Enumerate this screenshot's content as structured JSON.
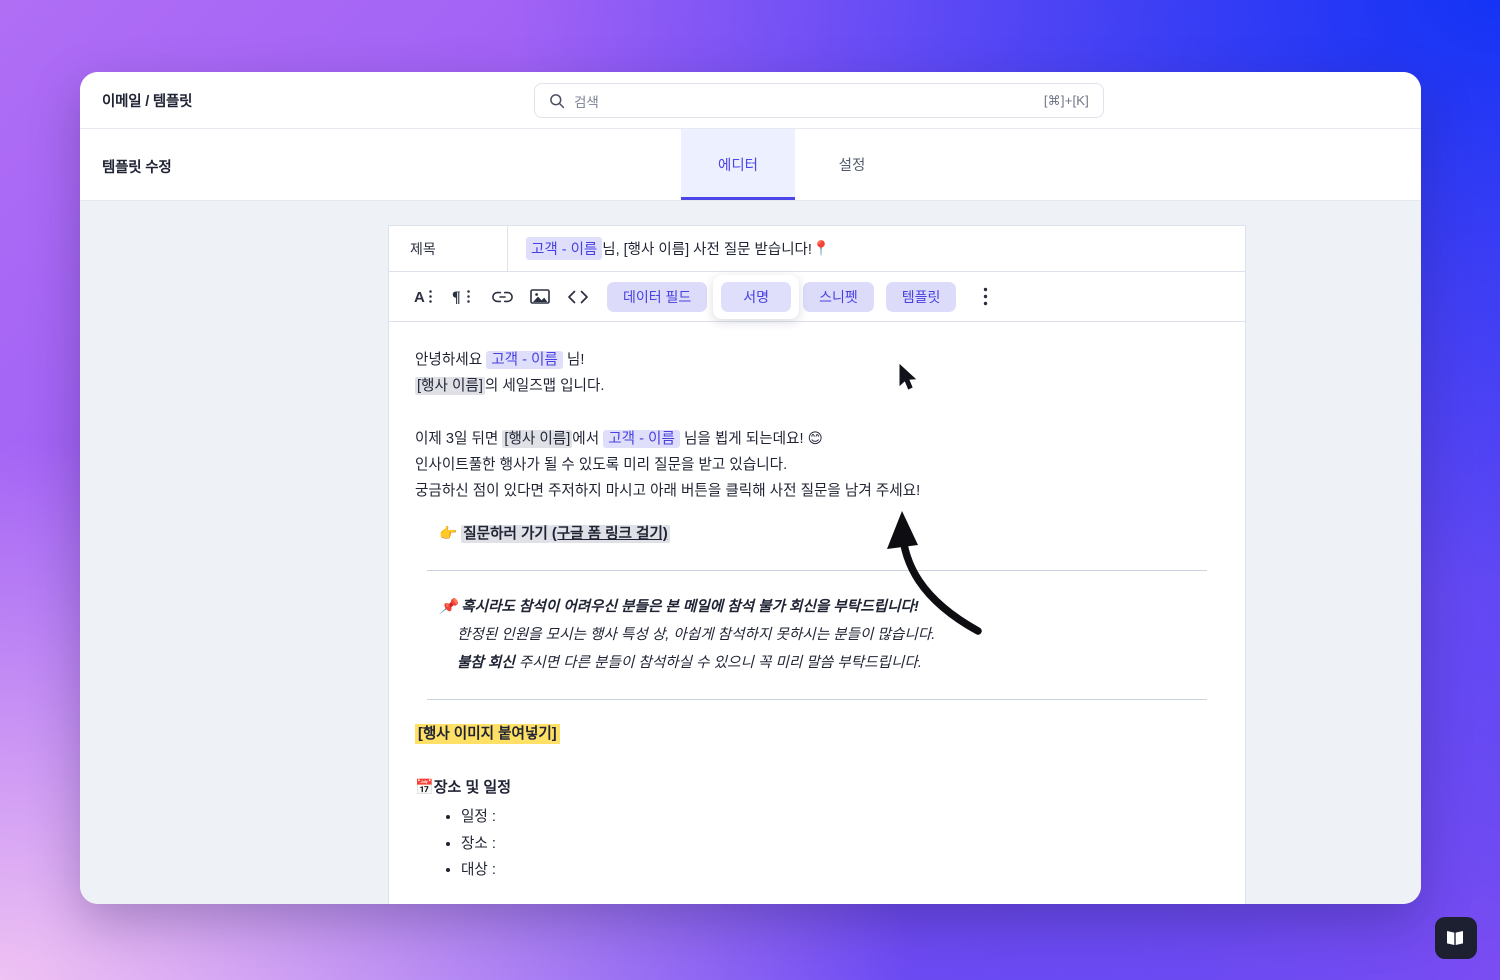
{
  "topbar": {
    "breadcrumb": "이메일 / 템플릿",
    "search": {
      "placeholder": "검색",
      "shortcut": "[⌘]+[K]",
      "icon": "search-icon"
    }
  },
  "header": {
    "page_title": "템플릿 수정",
    "tabs": [
      {
        "label": "에디터",
        "active": true
      },
      {
        "label": "설정",
        "active": false
      }
    ]
  },
  "editor": {
    "subject": {
      "label": "제목",
      "field_chip": "고객 - 이름",
      "rest": " 님, [행사 이름] 사전 질문 받습니다! ",
      "emoji": "📍"
    },
    "toolbar": {
      "icons": [
        {
          "name": "text-format-icon",
          "glyph": "A"
        },
        {
          "name": "paragraph-format-icon",
          "glyph": "¶"
        },
        {
          "name": "link-icon",
          "glyph": "link"
        },
        {
          "name": "image-icon",
          "glyph": "image"
        },
        {
          "name": "code-icon",
          "glyph": "<>"
        }
      ],
      "buttons": [
        {
          "label": "데이터 필드",
          "hovered": false
        },
        {
          "label": "서명",
          "hovered": true
        },
        {
          "label": "스니펫",
          "hovered": false
        },
        {
          "label": "템플릿",
          "hovered": false
        }
      ],
      "more_icon": "more-vertical-icon"
    },
    "body": {
      "greeting_pre": "안녕하세요 ",
      "greeting_chip": "고객 - 이름",
      "greeting_post": " 님!",
      "line2_chip": "[행사 이름]",
      "line2_post": "의 세일즈맵 입니다.",
      "line3_a": "이제 3일 뒤면 ",
      "line3_chip1": "[행사 이름]",
      "line3_b": "에서 ",
      "line3_chip2": "고객 - 이름",
      "line3_c": " 님을 뵙게 되는데요! ",
      "line3_emoji": "😊",
      "line4": "인사이트풀한 행사가 될 수 있도록 미리 질문을 받고 있습니다.",
      "line5": "궁금하신 점이 있다면 주저하지 마시고 아래 버튼을 클릭해 사전 질문을 남겨 주세요!",
      "cta_emoji": "👉",
      "cta_text": "질문하러 가기",
      "cta_link": "(구글 폼 링크 걸기)",
      "notice_emoji": "📌",
      "notice_line1": "혹시라도 참석이 어려우신 분들은 본 메일에 참석 불가 회신을 부탁드립니다!",
      "notice_line2": "한정된 인원을 모시는 행사 특성 상, 아쉽게 참석하지 못하시는 분들이 많습니다.",
      "notice_line3_bold": "불참 회신",
      "notice_line3_rest": " 주시면 다른 분들이 참석하실 수 있으니 꼭 미리 말씀 부탁드립니다.",
      "image_placeholder": "[행사 이미지 붙여넣기]",
      "section_emoji": "📅",
      "section_title": "장소 및 일정",
      "bullets": [
        "일정 :",
        "장소 :",
        "대상 :"
      ]
    }
  },
  "overlay": {
    "annotation_arrow": "curved-up-arrow",
    "cursor": "mouse-pointer",
    "corner_badge_icon": "book-panels-icon"
  },
  "colors": {
    "accent": "#4c45e8",
    "chip_bg": "#dfdffb",
    "chip_text": "#4840e0",
    "highlight_yellow": "#ffe066",
    "surface": "#eef1f6"
  }
}
